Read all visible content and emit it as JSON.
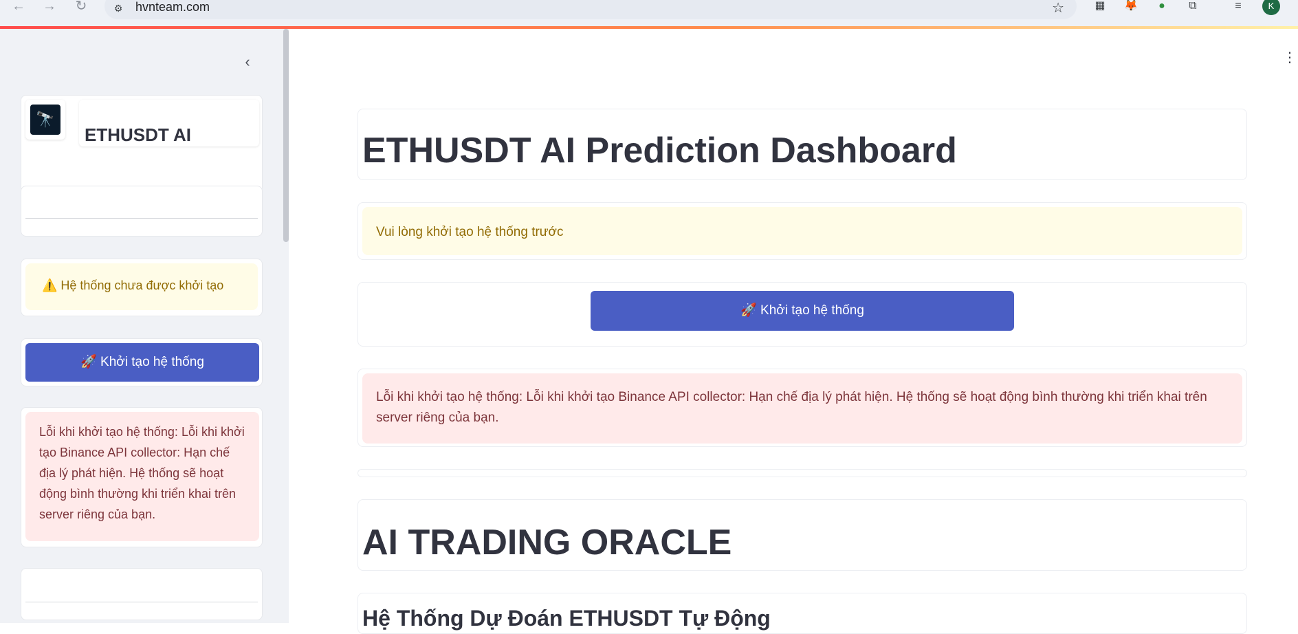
{
  "browser": {
    "url": "hvnteam.com",
    "back_icon": "←",
    "forward_icon": "→",
    "reload_icon": "↻",
    "star_icon": "☆",
    "avatar_initial": "K",
    "extensions": [
      "qr-code-icon",
      "metamask-fox-icon",
      "earth-extension-icon",
      "puzzle-extensions-icon",
      "reading-list-icon"
    ]
  },
  "sidebar": {
    "collapse_icon": "‹",
    "brand_title": "ETHUSDT AI",
    "warning_text": "⚠️ Hệ thống chưa được khởi tạo",
    "init_button": "🚀 Khởi tạo hệ thống",
    "error_text": "Lỗi khi khởi tạo hệ thống: Lỗi khi khởi tạo Binance API collector: Hạn chế địa lý phát hiện. Hệ thống sẽ hoạt động bình thường khi triển khai trên server riêng của bạn."
  },
  "main": {
    "more_icon": "⋮",
    "title": "ETHUSDT AI Prediction Dashboard",
    "warning_text": "Vui lòng khởi tạo hệ thống trước",
    "init_button": "🚀 Khởi tạo hệ thống",
    "error_text": "Lỗi khi khởi tạo hệ thống: Lỗi khi khởi tạo Binance API collector: Hạn chế địa lý phát hiện. Hệ thống sẽ hoạt động bình thường khi triển khai trên server riêng của bạn.",
    "oracle_title": "AI TRADING ORACLE",
    "subtitle": "Hệ Thống Dự Đoán ETHUSDT Tự Động"
  },
  "colors": {
    "primary_button": "#4a5ec4",
    "warning_bg": "#fffce7",
    "warning_text": "#926c05",
    "error_bg": "#ffeaea",
    "error_text": "#7d353b",
    "sidebar_bg": "#f0f2f6"
  }
}
